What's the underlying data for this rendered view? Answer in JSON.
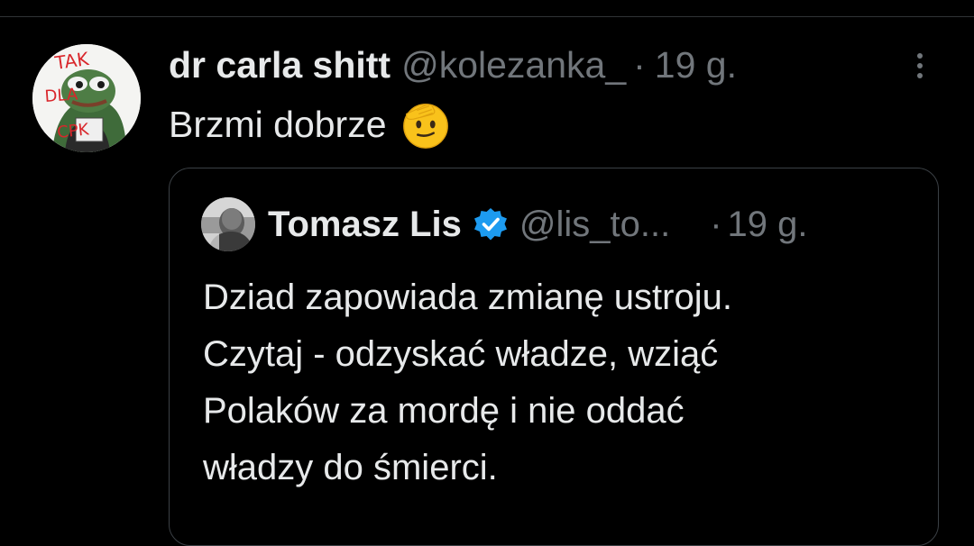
{
  "tweet": {
    "display_name": "dr carla shitt",
    "handle": "@kolezanka_",
    "separator": "·",
    "time": "19 g.",
    "text": "Brzmi dobrze",
    "emoji": "saluting-face-emoji",
    "avatar_icon": "pepe-frog-avatar",
    "avatar_text": [
      "TAK",
      "DLA",
      "CPK"
    ],
    "more_icon": "vertical-ellipsis-icon"
  },
  "quote": {
    "display_name": "Tomasz Lis",
    "verified_icon": "verified-badge-icon",
    "handle": "@lis_to...",
    "separator": "·",
    "time": "19 g.",
    "text_lines": [
      "Dziad zapowiada zmianę ustroju.",
      "Czytaj - odzyskać władze, wziąć",
      "Polaków za mordę i nie oddać",
      "władzy do śmierci."
    ],
    "avatar_icon": "profile-photo-avatar"
  },
  "colors": {
    "background": "#000000",
    "text_primary": "#e7e9ea",
    "text_secondary": "#71767b",
    "border": "#2f3336",
    "verified_blue": "#1d9bf0",
    "avatar_text_red": "#d9262b"
  }
}
